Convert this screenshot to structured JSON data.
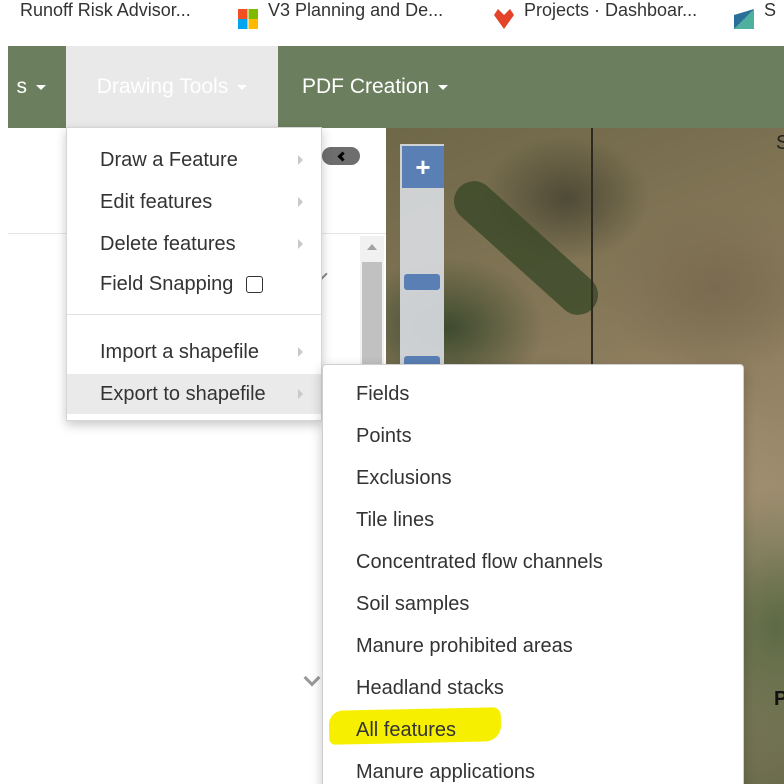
{
  "bookmarks": [
    {
      "label": "Runoff Risk Advisor...",
      "icon": "bookmark-partial-icon"
    },
    {
      "label": "V3 Planning and De...",
      "icon": "microsoft-icon"
    },
    {
      "label": "Projects · Dashboar...",
      "icon": "gitlab-icon"
    },
    {
      "label": "S",
      "icon": "bookmark-icon"
    }
  ],
  "navbar": {
    "left_partial": "s",
    "drawing_tools": "Drawing Tools",
    "pdf_creation": "PDF Creation",
    "bg_color": "#6b7f5f"
  },
  "drawing_menu": {
    "items": [
      {
        "label": "Draw a Feature",
        "has_submenu": true
      },
      {
        "label": "Edit features",
        "has_submenu": true
      },
      {
        "label": "Delete features",
        "has_submenu": true
      },
      {
        "label": "Field Snapping",
        "has_checkbox": true,
        "checked": false
      },
      {
        "label": "Import a shapefile",
        "has_submenu": true
      },
      {
        "label": "Export to shapefile",
        "has_submenu": true,
        "active": true
      }
    ]
  },
  "export_submenu": {
    "items": [
      "Fields",
      "Points",
      "Exclusions",
      "Tile lines",
      "Concentrated flow channels",
      "Soil samples",
      "Manure prohibited areas",
      "Headland stacks",
      "All features",
      "Manure applications"
    ],
    "highlighted": "All features",
    "highlight_color": "#f6f000"
  },
  "map": {
    "zoom_in_label": "+",
    "edge_label_top": "S",
    "edge_label_bottom": "P"
  }
}
